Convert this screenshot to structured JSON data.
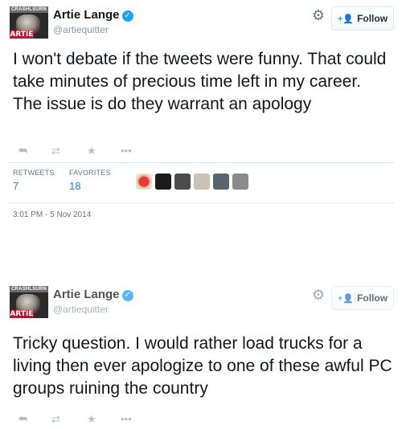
{
  "tweets": [
    {
      "avatar": {
        "top_text": "CRASHLSURN",
        "bottom_text": "ARTIE"
      },
      "full_name": "Artie Lange",
      "handle": "@artiequitter",
      "follow_label": "Follow",
      "text": "I won't debate if the tweets were funny. That could take minutes of precious time left in my career. The issue is do they warrant an apology",
      "stats": {
        "retweets_label": "RETWEETS",
        "retweets_count": "7",
        "favorites_label": "FAVORITES",
        "favorites_count": "18"
      },
      "timestamp": "3:01 PM - 5 Nov 2014",
      "favoriters": [
        "#e8e3d8",
        "#1b1b1b",
        "#4c4c4c",
        "#c9c1b3",
        "#5a6470",
        "#8a8a8a"
      ]
    },
    {
      "avatar": {
        "top_text": "CRASHLSURN",
        "bottom_text": "ARTIE"
      },
      "full_name": "Artie Lange",
      "handle": "@artiequitter",
      "follow_label": "Follow",
      "text": "Tricky question. I would rather load trucks for a living then ever apologize to one of these awful PC groups ruining the country"
    }
  ],
  "icons": {
    "reply": "reply-icon",
    "retweet": "retweet-icon",
    "favorite": "star-icon",
    "more": "more-icon",
    "gear": "gear-icon",
    "verified": "verified-badge-icon",
    "follow": "add-user-icon"
  },
  "colors": {
    "link_blue": "#1a88c9",
    "verified_blue": "#1da1f2",
    "muted": "#8899a6",
    "avatar_red": "#c8102e"
  }
}
